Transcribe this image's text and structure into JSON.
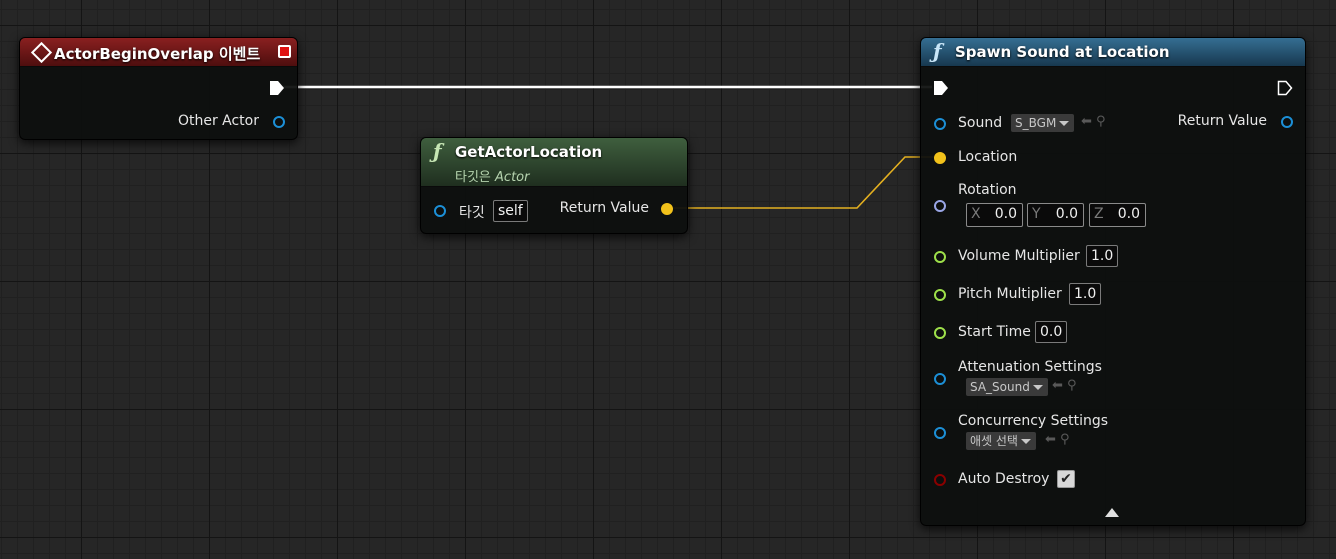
{
  "nodes": {
    "event": {
      "title": "ActorBeginOverlap 이벤트",
      "header_color": "#6b1616",
      "icon": "event-diamond-icon",
      "stop_icon": "delegate-square-icon",
      "pins": {
        "other_actor": "Other Actor"
      }
    },
    "get_location": {
      "title": "GetActorLocation",
      "subtitle_prefix": "타깃은",
      "subtitle_class": "Actor",
      "header_color": "#2f4a2f",
      "icon": "function-icon",
      "pins": {
        "target": "타깃",
        "target_value": "self",
        "return_value": "Return Value"
      }
    },
    "spawn_sound": {
      "title": "Spawn Sound at Location",
      "header_color": "#25506c",
      "icon": "function-icon",
      "pins": {
        "sound": "Sound",
        "sound_value": "S_BGM",
        "return_value": "Return Value",
        "location": "Location",
        "rotation": "Rotation",
        "rotation_x_label": "X",
        "rotation_x": "0.0",
        "rotation_y_label": "Y",
        "rotation_y": "0.0",
        "rotation_z_label": "Z",
        "rotation_z": "0.0",
        "volume": "Volume Multiplier",
        "volume_value": "1.0",
        "pitch": "Pitch Multiplier",
        "pitch_value": "1.0",
        "start_time": "Start Time",
        "start_time_value": "0.0",
        "attenuation": "Attenuation Settings",
        "attenuation_value": "SA_Sound",
        "concurrency": "Concurrency Settings",
        "concurrency_value": "애셋 선택",
        "auto_destroy": "Auto Destroy",
        "auto_destroy_checked": true
      }
    }
  },
  "pin_colors": {
    "exec": "#ffffff",
    "object": "#1c8fd6",
    "vector": "#f2c21b",
    "rotator": "#9aa6e6",
    "float": "#9ee04a",
    "bool": "#8a0000"
  }
}
